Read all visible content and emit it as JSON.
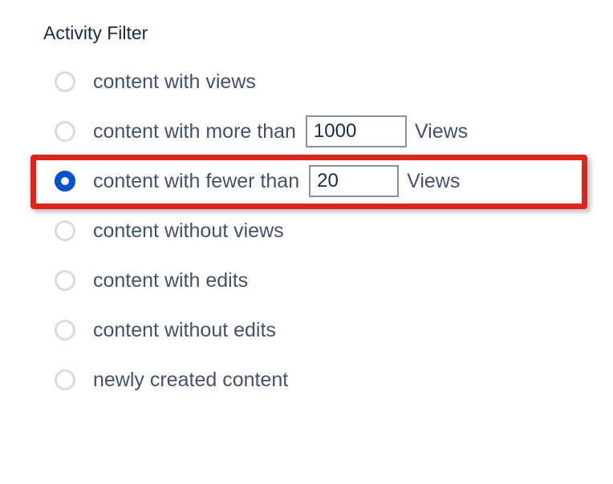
{
  "section": {
    "title": "Activity Filter"
  },
  "options": {
    "withViews": {
      "label": "content with views",
      "selected": false
    },
    "moreThan": {
      "label": "content with more than",
      "value": "1000",
      "suffix": "Views",
      "selected": false
    },
    "fewerThan": {
      "label": "content with fewer than",
      "value": "20",
      "suffix": "Views",
      "selected": true,
      "highlighted": true
    },
    "withoutViews": {
      "label": "content without views",
      "selected": false
    },
    "withEdits": {
      "label": "content with edits",
      "selected": false
    },
    "withoutEdits": {
      "label": "content without edits",
      "selected": false
    },
    "newlyCreated": {
      "label": "newly created content",
      "selected": false
    }
  },
  "colors": {
    "accent": "#0052CC",
    "highlight": "#E2231A",
    "textPrimary": "#172B4D",
    "textSecondary": "#42526E"
  }
}
